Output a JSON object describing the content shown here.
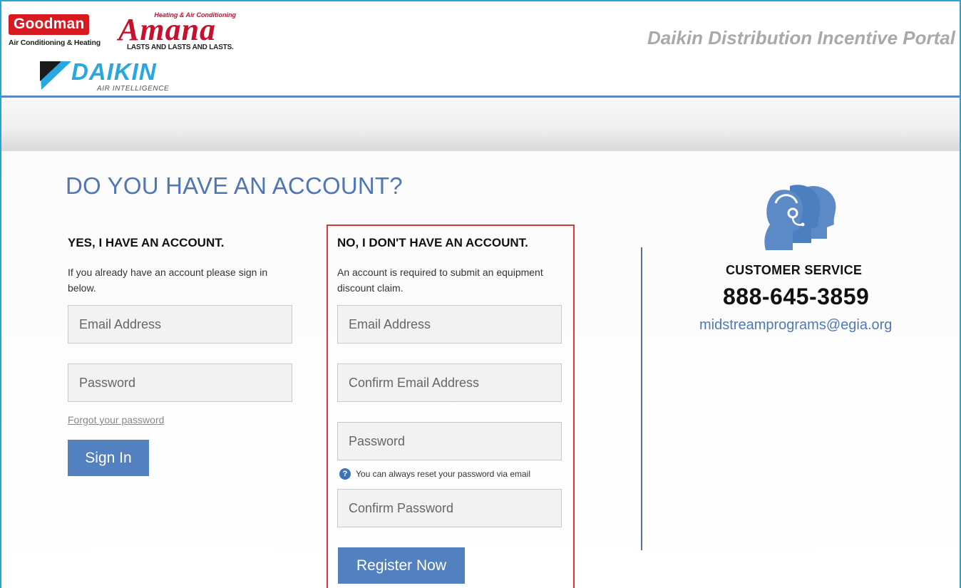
{
  "header": {
    "portal_title": "Daikin Distribution Incentive Portal",
    "logos": {
      "goodman_name": "Goodman",
      "goodman_tagline": "Air Conditioning & Heating",
      "amana_small": "Heating & Air Conditioning",
      "amana_name": "Amana",
      "amana_tagline": "LASTS AND LASTS AND LASTS.",
      "daikin_name": "DAIKIN",
      "daikin_tagline": "AIR INTELLIGENCE"
    }
  },
  "main": {
    "heading": "DO YOU HAVE AN ACCOUNT?"
  },
  "signin": {
    "heading": "YES, I HAVE AN ACCOUNT.",
    "description": "If you already have an account please sign in below.",
    "email_placeholder": "Email Address",
    "password_placeholder": "Password",
    "forgot_link": "Forgot your password",
    "button_label": "Sign In"
  },
  "register": {
    "heading": "NO, I DON'T HAVE AN ACCOUNT.",
    "description": "An account is required to submit an equipment discount claim.",
    "email_placeholder": "Email Address",
    "confirm_email_placeholder": "Confirm Email Address",
    "password_placeholder": "Password",
    "password_hint": "You can always reset your password via email",
    "confirm_password_placeholder": "Confirm Password",
    "button_label": "Register Now"
  },
  "customer_service": {
    "label": "CUSTOMER SERVICE",
    "phone": "888-645-3859",
    "email": "midstreamprograms@egia.org"
  },
  "colors": {
    "accent_blue": "#5380be",
    "highlight_red": "#d43939",
    "frame_cyan": "#27a3d8",
    "goodman_red": "#d71920",
    "amana_red": "#c8102e",
    "daikin_blue": "#2aa7df"
  },
  "icons": {
    "help": "question-circle-icon",
    "customer_service": "headset-agents-icon"
  }
}
